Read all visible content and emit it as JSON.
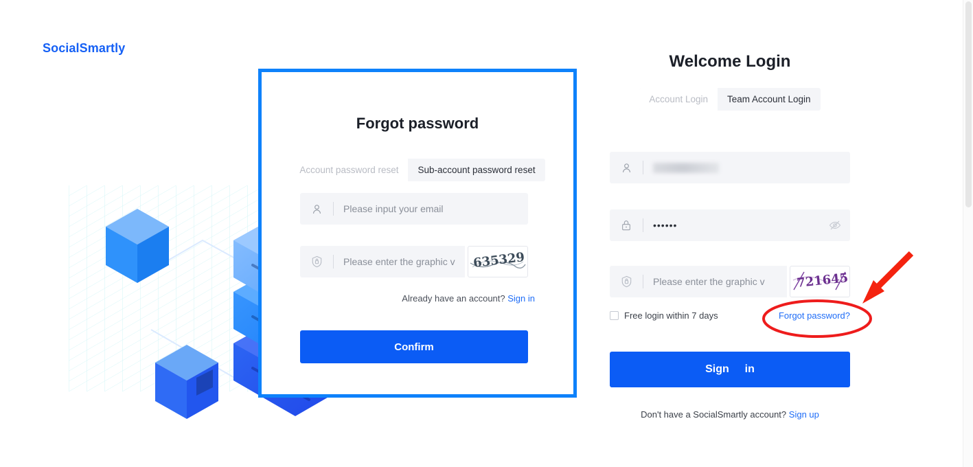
{
  "brand": {
    "name": "SocialSmartly"
  },
  "modal": {
    "title": "Forgot password",
    "tabs": [
      {
        "label": "Account password reset",
        "state": "inactive"
      },
      {
        "label": "Sub-account password reset",
        "state": "active"
      }
    ],
    "email_placeholder": "Please input your email",
    "captcha_placeholder": "Please enter the graphic v",
    "captcha_code": "635329",
    "already_text": "Already have an account?",
    "sign_in_link": "Sign in",
    "confirm_label": "Confirm",
    "border_color": "#0e82fb"
  },
  "login": {
    "title": "Welcome Login",
    "tabs": [
      {
        "label": "Account Login",
        "state": "inactive"
      },
      {
        "label": "Team Account Login",
        "state": "active"
      }
    ],
    "username_value": "",
    "username_redacted": true,
    "password_value": "••••••",
    "captcha_placeholder": "Please enter the graphic v",
    "captcha_code": "721645",
    "remember_label": "Free login within 7 days",
    "remember_checked": false,
    "forgot_label": "Forgot password?",
    "signin_label_part1": "Sign",
    "signin_label_part2": "in",
    "footer_text": "Don't have a SocialSmartly account?",
    "signup_link": "Sign up",
    "accent_color": "#0b5cf5"
  },
  "annotations": {
    "ellipse_color": "#ee1c1c",
    "arrow_color": "#f4230f",
    "ellipse_target": "Forgot password?",
    "arrow_points_to": "Forgot password?"
  },
  "icons": {
    "user": "user-icon",
    "shield": "shield-lock-icon",
    "lock": "lock-icon",
    "eye_off": "eye-off-icon"
  }
}
